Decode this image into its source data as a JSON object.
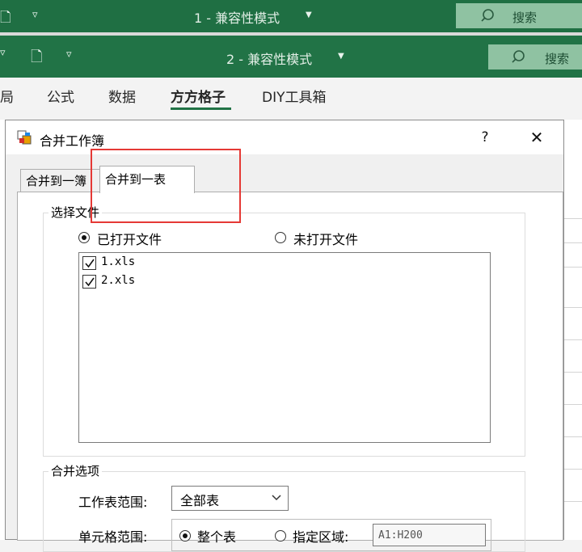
{
  "window1": {
    "title": "1 - 兼容性模式",
    "search_label": "搜索"
  },
  "window2": {
    "title": "2 - 兼容性模式",
    "search_label": "搜索"
  },
  "ribbon": {
    "tabs": [
      {
        "label": "局"
      },
      {
        "label": "公式"
      },
      {
        "label": "数据"
      },
      {
        "label": "方方格子"
      },
      {
        "label": "DIY工具箱"
      }
    ],
    "active_tab": "方方格子"
  },
  "dialog": {
    "title": "合并工作簿",
    "help": "?",
    "close": "✕",
    "tabs": [
      {
        "label": "合并到一簿",
        "active": false
      },
      {
        "label": "合并到一表",
        "active": true
      }
    ],
    "select_files": {
      "group_label": "选择文件",
      "options": [
        {
          "label": "已打开文件",
          "selected": true
        },
        {
          "label": "未打开文件",
          "selected": false
        }
      ],
      "files": [
        {
          "name": "1.xls",
          "checked": true
        },
        {
          "name": "2.xls",
          "checked": true
        }
      ]
    },
    "merge_options": {
      "group_label": "合并选项",
      "sheet_range_label": "工作表范围:",
      "sheet_range_value": "全部表",
      "cell_range_label": "单元格范围:",
      "cell_range_options": [
        {
          "label": "整个表",
          "selected": true
        },
        {
          "label": "指定区域:",
          "selected": false
        }
      ],
      "cell_range_value": "A1:H200"
    }
  },
  "colors": {
    "excel_green": "#217346",
    "highlight_red": "#e53935"
  }
}
